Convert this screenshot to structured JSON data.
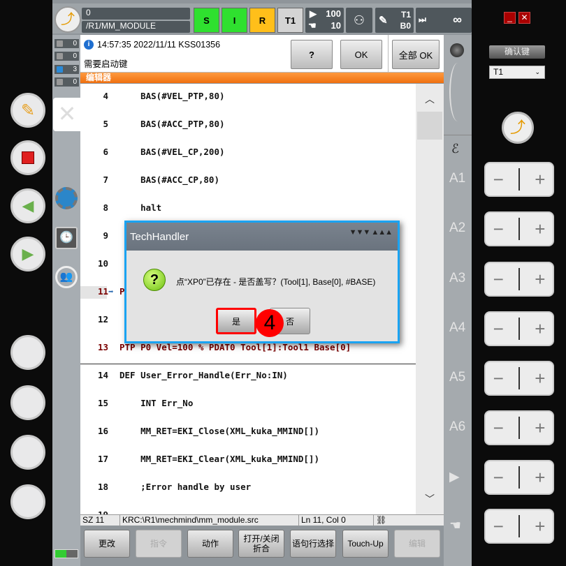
{
  "topbar": {
    "program_state": "0",
    "module_path": "/R1/MM_MODULE",
    "modes": [
      {
        "label": "S",
        "color": "#2fe02f"
      },
      {
        "label": "I",
        "color": "#2fe02f"
      },
      {
        "label": "R",
        "color": "#ffbf1a"
      },
      {
        "label": "T1",
        "color": "#d4d4d4"
      }
    ],
    "override_prog": "100",
    "override_jog": "10",
    "tool": "T1",
    "base": "B0",
    "increment": "∞"
  },
  "counters": [
    {
      "type": "ack",
      "value": "0"
    },
    {
      "type": "warning",
      "value": "0"
    },
    {
      "type": "info",
      "value": "3"
    },
    {
      "type": "wait",
      "value": "0"
    }
  ],
  "message": {
    "header": "14:57:35 2022/11/11 KSS01356",
    "text": "需要启动键",
    "help_label": "?",
    "ok_label": "OK",
    "all_ok_label": "全部 OK"
  },
  "editor": {
    "title": "编辑器",
    "lines": [
      {
        "num": "4",
        "text": "    BAS(#VEL_PTP,80)"
      },
      {
        "num": "5",
        "text": "    BAS(#ACC_PTP,80)"
      },
      {
        "num": "6",
        "text": "    BAS(#VEL_CP,200)"
      },
      {
        "num": "7",
        "text": "    BAS(#ACC_CP,80)"
      },
      {
        "num": "8",
        "text": "    halt"
      },
      {
        "num": "9",
        "text": ""
      },
      {
        "num": "10",
        "text": ""
      },
      {
        "num": "11",
        "text": "P",
        "current": true
      },
      {
        "num": "12",
        "text": ""
      },
      {
        "num": "13",
        "text": "PTP P0 Vel=100 % PDAT0 Tool[1]:Tool1 Base[0]",
        "fold": true
      },
      {
        "num": "14",
        "text": "DEF User_Error_Handle(Err_No:IN)"
      },
      {
        "num": "15",
        "text": "    INT Err_No"
      },
      {
        "num": "16",
        "text": "    MM_RET=EKI_Close(XML_kuka_MMIND[])"
      },
      {
        "num": "17",
        "text": "    MM_RET=EKI_Clear(XML_kuka_MMIND[])"
      },
      {
        "num": "18",
        "text": "    ;Error handle by user"
      },
      {
        "num": "19",
        "text": ""
      }
    ]
  },
  "status": {
    "sz": "SZ 11",
    "path": "KRC:\\R1\\mechmind\\mm_module.src",
    "position": "Ln 11, Col 0"
  },
  "softkeys": [
    {
      "label": "更改",
      "enabled": true
    },
    {
      "label": "指令",
      "enabled": false
    },
    {
      "label": "动作",
      "enabled": true
    },
    {
      "label": "打开/关闭 折合",
      "enabled": true
    },
    {
      "label": "语句行选择",
      "enabled": true
    },
    {
      "label": "Touch-Up",
      "enabled": true
    },
    {
      "label": "编辑",
      "enabled": false
    }
  ],
  "right": {
    "confirm_label": "确认键",
    "mode_select": "T1",
    "axes": [
      "A1",
      "A2",
      "A3",
      "A4",
      "A5",
      "A6"
    ]
  },
  "dialog": {
    "title": "TechHandler",
    "message": "点“XP0”已存在 - 是否盖写？(Tool[1], Base[0], #BASE)",
    "yes_label": "是",
    "no_label": "否",
    "step_badge": "4"
  }
}
